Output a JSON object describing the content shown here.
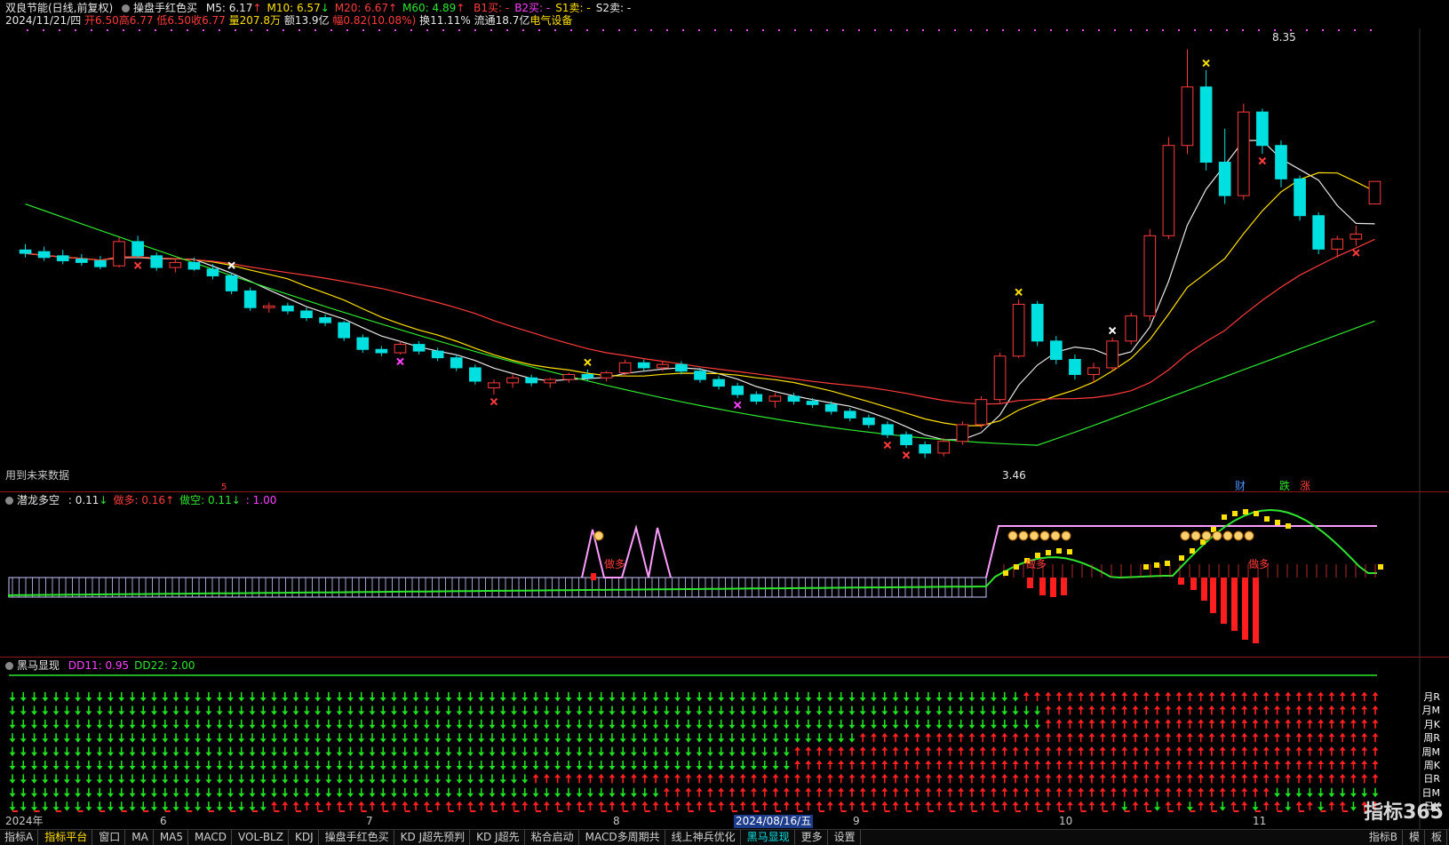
{
  "header": {
    "stock_name": "双良节能(日线,前复权)",
    "indicator_name": "操盘手红色买",
    "ma_values": [
      {
        "label": "M5: 6.17",
        "color": "#e8e8e8",
        "arrow": "↑",
        "arrow_color": "#ff3b3b"
      },
      {
        "label": "M10: 6.57",
        "color": "#ffe000",
        "arrow": "↓",
        "arrow_color": "#2ee62e"
      },
      {
        "label": "M20: 6.67",
        "color": "#ff3b3b",
        "arrow": "↑",
        "arrow_color": "#ff3b3b"
      },
      {
        "label": "M60: 4.89",
        "color": "#2ee62e",
        "arrow": "↑",
        "arrow_color": "#ff3b3b"
      }
    ],
    "signals": [
      {
        "label": "B1买: -",
        "color": "#ff3b3b"
      },
      {
        "label": "B2买: -",
        "color": "#ff40ff"
      },
      {
        "label": "S1卖: -",
        "color": "#ffe000"
      },
      {
        "label": "S2卖: -",
        "color": "#e8e8e8"
      }
    ],
    "date": "2024/11/21/四",
    "open": "开6.50",
    "high": "高6.77",
    "low": "低6.50",
    "close": "收6.77",
    "volume": "量207.8万",
    "amount": "额13.9亿",
    "change": "幅0.82(10.08%)",
    "turnover": "换11.11%",
    "float_cap": "流通18.7亿",
    "sector": "电气设备"
  },
  "main_chart": {
    "future_data_note": "用到未来数据",
    "high_label": "8.35",
    "low_label": "3.46",
    "event_labels": [
      {
        "text": "财",
        "color": "#4a90ff"
      },
      {
        "text": "跌",
        "color": "#2ee62e"
      },
      {
        "text": "涨",
        "color": "#ff3b3b"
      }
    ],
    "small_marker": "5"
  },
  "panel2": {
    "title": "潜龙多空",
    "values": [
      {
        "label": ": 0.11",
        "color": "#e8e8e8",
        "arrow": "↓",
        "arrow_color": "#2ee62e"
      },
      {
        "label": "做多: 0.16",
        "color": "#ff3b3b",
        "arrow": "↑",
        "arrow_color": "#ff3b3b"
      },
      {
        "label": "做空: 0.11",
        "color": "#2ee62e",
        "arrow": "↓",
        "arrow_color": "#2ee62e"
      },
      {
        "label": ": 1.00",
        "color": "#ff40ff",
        "arrow": "",
        "arrow_color": ""
      }
    ],
    "zuoduo_labels": [
      "做多",
      "做多",
      "做多"
    ]
  },
  "panel3": {
    "title": "黑马显现",
    "values": [
      {
        "label": "DD11: 0.95",
        "color": "#ff40ff"
      },
      {
        "label": "DD22: 2.00",
        "color": "#2ee62e"
      }
    ],
    "row_labels": [
      "月R",
      "月M",
      "月K",
      "周R",
      "周M",
      "周K",
      "日R",
      "日M",
      "日K"
    ]
  },
  "date_axis": [
    {
      "label": "2024年",
      "selected": false
    },
    {
      "label": "6",
      "selected": false
    },
    {
      "label": "7",
      "selected": false
    },
    {
      "label": "8",
      "selected": false
    },
    {
      "label": "2024/08/16/五",
      "selected": true
    },
    {
      "label": "9",
      "selected": false
    },
    {
      "label": "10",
      "selected": false
    },
    {
      "label": "11",
      "selected": false
    }
  ],
  "tabs": [
    {
      "label": "指标A",
      "state": "normal"
    },
    {
      "label": "指标平台",
      "state": "active"
    },
    {
      "label": "窗口",
      "state": "normal"
    },
    {
      "label": "MA",
      "state": "normal"
    },
    {
      "label": "MA5",
      "state": "normal"
    },
    {
      "label": "MACD",
      "state": "normal"
    },
    {
      "label": "VOL-BLZ",
      "state": "normal"
    },
    {
      "label": "KDJ",
      "state": "normal"
    },
    {
      "label": "操盘手红色买",
      "state": "normal"
    },
    {
      "label": "KD J超先预判",
      "state": "normal"
    },
    {
      "label": "KD J超先",
      "state": "normal"
    },
    {
      "label": "粘合启动",
      "state": "normal"
    },
    {
      "label": "MACD多周期共",
      "state": "normal"
    },
    {
      "label": "线上神兵优化",
      "state": "normal"
    },
    {
      "label": "黑马显现",
      "state": "hl"
    },
    {
      "label": "更多",
      "state": "normal"
    },
    {
      "label": "设置",
      "state": "normal"
    }
  ],
  "tabs_right": [
    "指标B",
    "模",
    "板"
  ],
  "brand": "指标365",
  "colors": {
    "up": "#ff3b3b",
    "down": "#00e0e0",
    "ma5": "#e8e8e8",
    "ma10": "#ffe000",
    "ma20": "#ff3b3b",
    "ma60": "#2ee62e",
    "magenta": "#ff40ff",
    "background": "#000000"
  },
  "chart_data": {
    "type": "candlestick",
    "dates_range": [
      "2024年",
      "11"
    ],
    "ylim": [
      3.2,
      8.6
    ],
    "candles": [
      {
        "o": 5.95,
        "h": 6.02,
        "l": 5.86,
        "c": 5.91
      },
      {
        "o": 5.93,
        "h": 5.99,
        "l": 5.82,
        "c": 5.86
      },
      {
        "o": 5.88,
        "h": 5.95,
        "l": 5.78,
        "c": 5.82
      },
      {
        "o": 5.84,
        "h": 5.9,
        "l": 5.76,
        "c": 5.8
      },
      {
        "o": 5.82,
        "h": 5.88,
        "l": 5.72,
        "c": 5.75
      },
      {
        "o": 5.76,
        "h": 6.1,
        "l": 5.74,
        "c": 6.05
      },
      {
        "o": 6.05,
        "h": 6.12,
        "l": 5.85,
        "c": 5.88
      },
      {
        "o": 5.88,
        "h": 5.92,
        "l": 5.7,
        "c": 5.74
      },
      {
        "o": 5.74,
        "h": 5.84,
        "l": 5.68,
        "c": 5.8
      },
      {
        "o": 5.8,
        "h": 5.86,
        "l": 5.7,
        "c": 5.72
      },
      {
        "o": 5.72,
        "h": 5.78,
        "l": 5.6,
        "c": 5.64
      },
      {
        "o": 5.64,
        "h": 5.68,
        "l": 5.42,
        "c": 5.46
      },
      {
        "o": 5.46,
        "h": 5.5,
        "l": 5.22,
        "c": 5.26
      },
      {
        "o": 5.26,
        "h": 5.32,
        "l": 5.2,
        "c": 5.28
      },
      {
        "o": 5.28,
        "h": 5.32,
        "l": 5.18,
        "c": 5.22
      },
      {
        "o": 5.22,
        "h": 5.26,
        "l": 5.1,
        "c": 5.14
      },
      {
        "o": 5.14,
        "h": 5.18,
        "l": 5.04,
        "c": 5.08
      },
      {
        "o": 5.08,
        "h": 5.1,
        "l": 4.86,
        "c": 4.9
      },
      {
        "o": 4.9,
        "h": 4.94,
        "l": 4.72,
        "c": 4.76
      },
      {
        "o": 4.76,
        "h": 4.8,
        "l": 4.68,
        "c": 4.72
      },
      {
        "o": 4.72,
        "h": 4.86,
        "l": 4.7,
        "c": 4.82
      },
      {
        "o": 4.82,
        "h": 4.86,
        "l": 4.7,
        "c": 4.74
      },
      {
        "o": 4.74,
        "h": 4.78,
        "l": 4.62,
        "c": 4.66
      },
      {
        "o": 4.66,
        "h": 4.7,
        "l": 4.5,
        "c": 4.54
      },
      {
        "o": 4.54,
        "h": 4.58,
        "l": 4.34,
        "c": 4.38
      },
      {
        "o": 4.3,
        "h": 4.4,
        "l": 4.22,
        "c": 4.36
      },
      {
        "o": 4.36,
        "h": 4.46,
        "l": 4.3,
        "c": 4.42
      },
      {
        "o": 4.42,
        "h": 4.46,
        "l": 4.32,
        "c": 4.36
      },
      {
        "o": 4.36,
        "h": 4.42,
        "l": 4.3,
        "c": 4.4
      },
      {
        "o": 4.4,
        "h": 4.48,
        "l": 4.36,
        "c": 4.46
      },
      {
        "o": 4.46,
        "h": 4.52,
        "l": 4.38,
        "c": 4.42
      },
      {
        "o": 4.42,
        "h": 4.5,
        "l": 4.38,
        "c": 4.48
      },
      {
        "o": 4.48,
        "h": 4.64,
        "l": 4.44,
        "c": 4.6
      },
      {
        "o": 4.6,
        "h": 4.64,
        "l": 4.5,
        "c": 4.54
      },
      {
        "o": 4.54,
        "h": 4.62,
        "l": 4.5,
        "c": 4.58
      },
      {
        "o": 4.58,
        "h": 4.62,
        "l": 4.46,
        "c": 4.5
      },
      {
        "o": 4.5,
        "h": 4.54,
        "l": 4.36,
        "c": 4.4
      },
      {
        "o": 4.4,
        "h": 4.44,
        "l": 4.28,
        "c": 4.32
      },
      {
        "o": 4.32,
        "h": 4.36,
        "l": 4.18,
        "c": 4.22
      },
      {
        "o": 4.22,
        "h": 4.26,
        "l": 4.1,
        "c": 4.14
      },
      {
        "o": 4.14,
        "h": 4.24,
        "l": 4.06,
        "c": 4.2
      },
      {
        "o": 4.2,
        "h": 4.24,
        "l": 4.1,
        "c": 4.14
      },
      {
        "o": 4.14,
        "h": 4.18,
        "l": 4.06,
        "c": 4.1
      },
      {
        "o": 4.1,
        "h": 4.14,
        "l": 3.98,
        "c": 4.02
      },
      {
        "o": 4.02,
        "h": 4.06,
        "l": 3.9,
        "c": 3.94
      },
      {
        "o": 3.94,
        "h": 3.98,
        "l": 3.82,
        "c": 3.86
      },
      {
        "o": 3.86,
        "h": 3.9,
        "l": 3.7,
        "c": 3.74
      },
      {
        "o": 3.74,
        "h": 3.78,
        "l": 3.58,
        "c": 3.62
      },
      {
        "o": 3.62,
        "h": 3.66,
        "l": 3.46,
        "c": 3.52
      },
      {
        "o": 3.52,
        "h": 3.7,
        "l": 3.48,
        "c": 3.66
      },
      {
        "o": 3.66,
        "h": 3.9,
        "l": 3.62,
        "c": 3.86
      },
      {
        "o": 3.86,
        "h": 4.2,
        "l": 3.82,
        "c": 4.16
      },
      {
        "o": 4.16,
        "h": 4.72,
        "l": 4.12,
        "c": 4.68
      },
      {
        "o": 4.68,
        "h": 5.36,
        "l": 4.66,
        "c": 5.3
      },
      {
        "o": 5.3,
        "h": 5.34,
        "l": 4.8,
        "c": 4.86
      },
      {
        "o": 4.86,
        "h": 4.92,
        "l": 4.58,
        "c": 4.64
      },
      {
        "o": 4.64,
        "h": 4.7,
        "l": 4.4,
        "c": 4.46
      },
      {
        "o": 4.46,
        "h": 4.6,
        "l": 4.36,
        "c": 4.54
      },
      {
        "o": 4.54,
        "h": 4.9,
        "l": 4.5,
        "c": 4.86
      },
      {
        "o": 4.86,
        "h": 5.2,
        "l": 4.82,
        "c": 5.16
      },
      {
        "o": 5.16,
        "h": 6.2,
        "l": 5.1,
        "c": 6.12
      },
      {
        "o": 6.12,
        "h": 7.3,
        "l": 6.08,
        "c": 7.2
      },
      {
        "o": 7.2,
        "h": 8.35,
        "l": 7.1,
        "c": 7.9
      },
      {
        "o": 7.9,
        "h": 8.1,
        "l": 6.9,
        "c": 7.0
      },
      {
        "o": 7.0,
        "h": 7.4,
        "l": 6.5,
        "c": 6.6
      },
      {
        "o": 6.6,
        "h": 7.7,
        "l": 6.55,
        "c": 7.6
      },
      {
        "o": 7.6,
        "h": 7.64,
        "l": 7.1,
        "c": 7.2
      },
      {
        "o": 7.2,
        "h": 7.26,
        "l": 6.7,
        "c": 6.8
      },
      {
        "o": 6.8,
        "h": 6.84,
        "l": 6.3,
        "c": 6.36
      },
      {
        "o": 6.36,
        "h": 6.4,
        "l": 5.9,
        "c": 5.96
      },
      {
        "o": 5.96,
        "h": 6.12,
        "l": 5.86,
        "c": 6.08
      },
      {
        "o": 6.08,
        "h": 6.24,
        "l": 6.0,
        "c": 6.14
      },
      {
        "o": 6.5,
        "h": 6.77,
        "l": 6.5,
        "c": 6.77
      }
    ]
  }
}
